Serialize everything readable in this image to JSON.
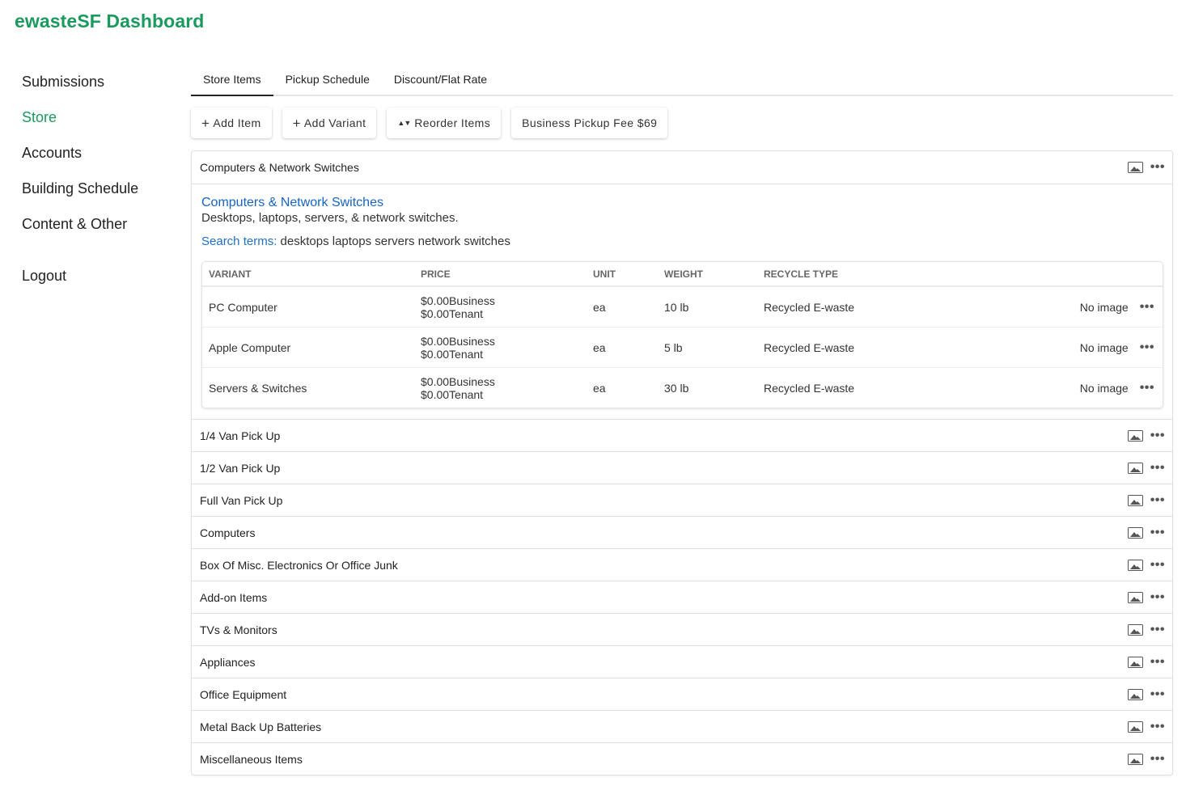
{
  "app": {
    "title": "ewasteSF Dashboard"
  },
  "sidebar": {
    "items": [
      {
        "label": "Submissions"
      },
      {
        "label": "Store"
      },
      {
        "label": "Accounts"
      },
      {
        "label": "Building Schedule"
      },
      {
        "label": "Content & Other"
      }
    ],
    "logout": "Logout",
    "active_color": "#1a9a5e"
  },
  "tabs": [
    {
      "label": "Store Items"
    },
    {
      "label": "Pickup Schedule"
    },
    {
      "label": "Discount/Flat Rate"
    }
  ],
  "toolbar": {
    "add_item": "Add Item",
    "add_variant": "Add Variant",
    "reorder_items": "Reorder Items",
    "pickup_fee": "Business Pickup Fee $69"
  },
  "expanded_item": {
    "header": "Computers & Network Switches",
    "title": "Computers & Network Switches",
    "description": "Desktops, laptops, servers, & network switches.",
    "search_terms_label": "Search terms:",
    "search_terms": " desktops laptops servers network switches",
    "columns": [
      "VARIANT",
      "PRICE",
      "UNIT",
      "WEIGHT",
      "RECYCLE TYPE"
    ],
    "variants": [
      {
        "name": "PC Computer",
        "price_business": "$0.00Business",
        "price_tenant": "$0.00Tenant",
        "unit": "ea",
        "weight": "10 lb",
        "recycle_type": "Recycled E-waste",
        "image": "No image"
      },
      {
        "name": "Apple Computer",
        "price_business": "$0.00Business",
        "price_tenant": "$0.00Tenant",
        "unit": "ea",
        "weight": "5 lb",
        "recycle_type": "Recycled E-waste",
        "image": "No image"
      },
      {
        "name": "Servers & Switches",
        "price_business": "$0.00Business",
        "price_tenant": "$0.00Tenant",
        "unit": "ea",
        "weight": "30 lb",
        "recycle_type": "Recycled E-waste",
        "image": "No image"
      }
    ]
  },
  "items": [
    "1/4 Van Pick Up",
    "1/2 Van Pick Up",
    "Full Van Pick Up",
    "Computers",
    "Box Of Misc. Electronics Or Office Junk",
    "Add-on Items",
    "TVs & Monitors",
    "Appliances",
    "Office Equipment",
    "Metal Back Up Batteries",
    "Miscellaneous Items"
  ],
  "icons": {
    "image": "image-icon",
    "more": "more-horizontal-icon",
    "add": "plus-icon",
    "sort": "sort-icon"
  }
}
